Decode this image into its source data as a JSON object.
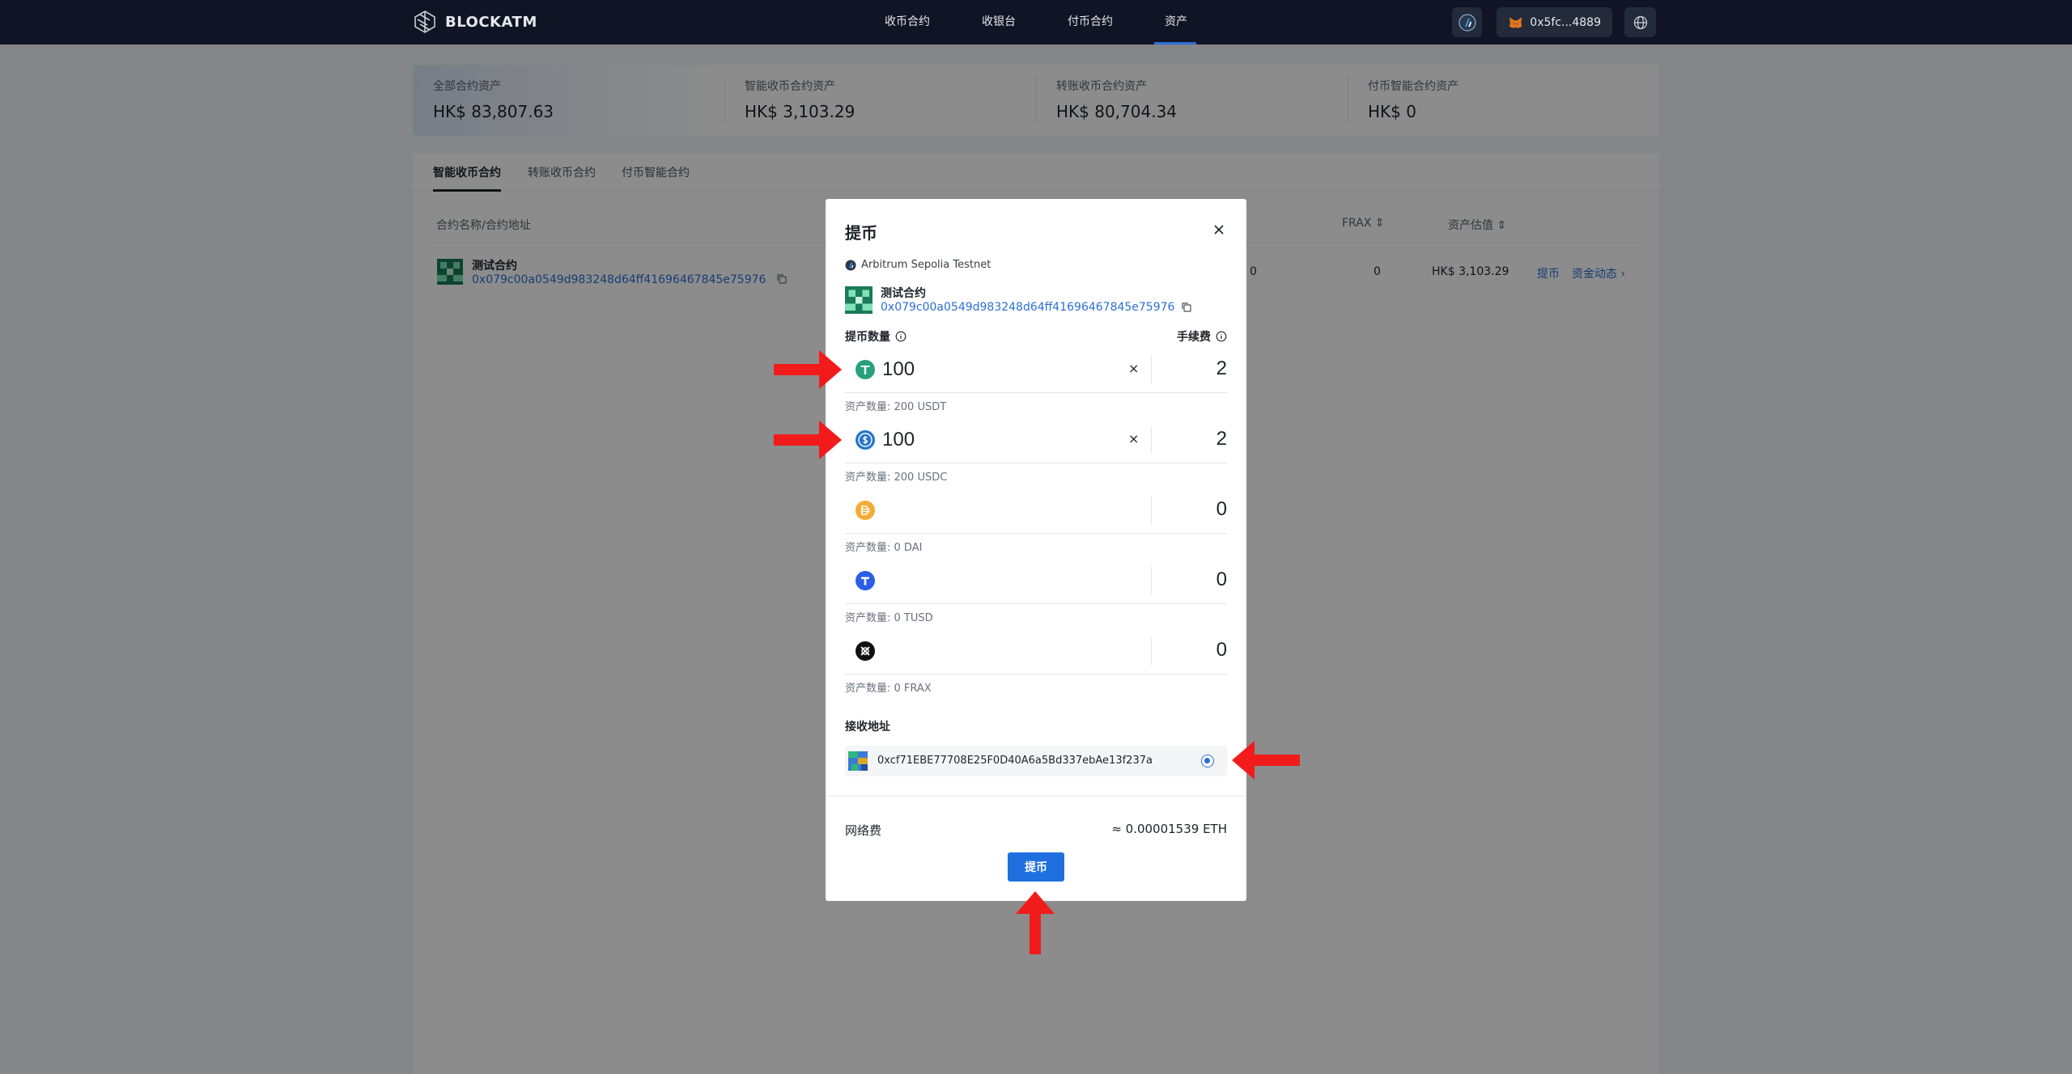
{
  "app": {
    "brand": "BLOCKATM"
  },
  "nav": {
    "items": [
      "收币合约",
      "收银台",
      "付币合约",
      "资产"
    ],
    "active": "资产",
    "wallet": "0x5fc...4889"
  },
  "stats": [
    {
      "label": "全部合约资产",
      "value": "HK$ 83,807.63"
    },
    {
      "label": "智能收币合约资产",
      "value": "HK$ 3,103.29"
    },
    {
      "label": "转账收币合约资产",
      "value": "HK$ 80,704.34"
    },
    {
      "label": "付币智能合约资产",
      "value": "HK$ 0"
    }
  ],
  "tabs": [
    "智能收币合约",
    "转账收币合约",
    "付币智能合约"
  ],
  "table": {
    "col_name": "合约名称/合约地址",
    "col_frax": "FRAX ⇕",
    "col_value": "资产估值 ⇕",
    "row": {
      "name": "测试合约",
      "address": "0x079c00a0549d983248d64ff41696467845e75976",
      "dai": "0",
      "frax": "0",
      "value": "HK$ 3,103.29",
      "withdraw": "提币",
      "activity": "资金动态 ›"
    }
  },
  "modal": {
    "title": "提币",
    "network": "Arbitrum Sepolia Testnet",
    "contract_name": "测试合约",
    "contract_address": "0x079c00a0549d983248d64ff41696467845e75976",
    "amount_label": "提币数量",
    "fee_label": "手续费",
    "assets": [
      {
        "symbol": "USDT",
        "amount": "100",
        "clear": "×",
        "fee": "2",
        "balance": "资产数量: 200 USDT",
        "color": "#26a17b"
      },
      {
        "symbol": "USDC",
        "amount": "100",
        "clear": "×",
        "fee": "2",
        "balance": "资产数量: 200 USDC",
        "color": "#2775ca"
      },
      {
        "symbol": "DAI",
        "amount": "",
        "clear": "",
        "fee": "0",
        "balance": "资产数量: 0 DAI",
        "color": "#f5ac37"
      },
      {
        "symbol": "TUSD",
        "amount": "",
        "clear": "",
        "fee": "0",
        "balance": "资产数量: 0 TUSD",
        "color": "#2b5ee6"
      },
      {
        "symbol": "FRAX",
        "amount": "",
        "clear": "",
        "fee": "0",
        "balance": "资产数量: 0 FRAX",
        "color": "#111111"
      }
    ],
    "recv_label": "接收地址",
    "recv_address": "0xcf71EBE77708E25F0D40A6a5Bd337ebAe13f237a",
    "network_fee_label": "网络费",
    "network_fee_value": "≈ 0.00001539 ETH",
    "submit": "提币"
  }
}
